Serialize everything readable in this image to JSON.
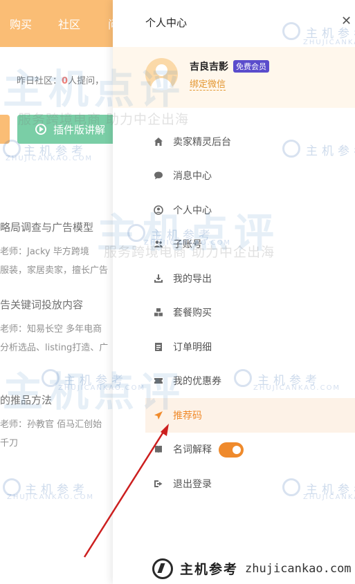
{
  "nav": {
    "items": [
      "购买",
      "社区",
      "问"
    ]
  },
  "stats": {
    "prefix": "昨日社区：",
    "count": "0",
    "suffix": "人提问，"
  },
  "plugin_button": {
    "label": "插件版讲解"
  },
  "courses": [
    {
      "title": "略局调查与广告模型",
      "lines": [
        "老师：Jacky  毕方跨境",
        "服装，家居卖家，擅长广告"
      ]
    },
    {
      "title": "告关键词投放内容",
      "lines": [
        "老师：知易长空  多年电商",
        "分析选品、listing打造、广"
      ]
    },
    {
      "title": "的推品方法",
      "lines": [
        "老师：孙教官 佰马汇创始",
        "千刀"
      ]
    }
  ],
  "drawer": {
    "title": "个人中心",
    "close": "✕",
    "user": {
      "name": "吉良吉影",
      "badge": "免费会员",
      "bind": "绑定微信"
    },
    "menu": [
      {
        "label": "卖家精灵后台",
        "icon": "home-icon"
      },
      {
        "label": "消息中心",
        "icon": "message-icon"
      },
      {
        "label": "个人中心",
        "icon": "user-icon"
      },
      {
        "label": "子账号",
        "icon": "users-icon"
      },
      {
        "label": "我的导出",
        "icon": "download-icon"
      },
      {
        "label": "套餐购买",
        "icon": "package-icon"
      },
      {
        "label": "订单明细",
        "icon": "order-icon"
      },
      {
        "label": "我的优惠券",
        "icon": "ticket-icon"
      },
      {
        "label": "推荐码",
        "icon": "send-icon",
        "active": true
      },
      {
        "label": "名词解释",
        "icon": "book-icon",
        "toggle": true
      },
      {
        "label": "退出登录",
        "icon": "logout-icon"
      }
    ],
    "glossary_toggle_on": true
  },
  "watermark": {
    "cn": "主机参考",
    "en": "ZHUJICANKAO.COM",
    "big": "主机点评",
    "slogan": "服务跨境电商 助力中企出海"
  },
  "footer": {
    "cn": "主机参考",
    "url": "zhujicankao.com"
  },
  "colors": {
    "accent": "#f08b2c",
    "nav": "#f79a2c",
    "green": "#33b477",
    "badge": "#5a4ccc",
    "arrow": "#cc1f1f"
  }
}
